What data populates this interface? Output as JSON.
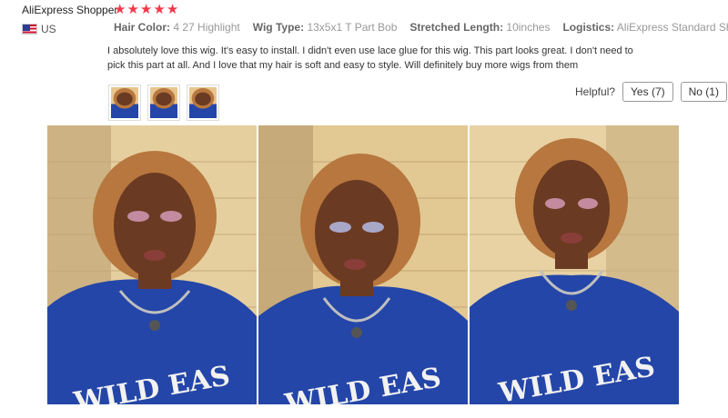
{
  "review": {
    "reviewer": "AliExpress Shopper",
    "rating": 5,
    "star_char": "★",
    "country": "US",
    "attributes": [
      {
        "key": "Hair Color:",
        "value": "4 27 Highlight"
      },
      {
        "key": "Wig Type:",
        "value": "13x5x1 T Part Bob"
      },
      {
        "key": "Stretched Length:",
        "value": "10inches"
      },
      {
        "key": "Logistics:",
        "value": "AliExpress Standard Shipping"
      }
    ],
    "text": "I absolutely love this wig. It's easy to install. I didn't even use lace glue for this wig. This part looks great. I don't need to pick this part at all. And I love that my hair is soft and easy to style. Will definitely buy more wigs from them"
  },
  "helpful": {
    "label": "Helpful?",
    "yes_label": "Yes (7)",
    "no_label": "No (1)"
  },
  "colors": {
    "star": "#f3384a",
    "wall": "#d9c39a",
    "shirt": "#2446a8",
    "hair": "#b7773e",
    "skin": "#6b3a22"
  },
  "photos": [
    {
      "print": "WILD EAS"
    },
    {
      "print": "WILD EAS"
    },
    {
      "print": "WILD EAS"
    }
  ]
}
